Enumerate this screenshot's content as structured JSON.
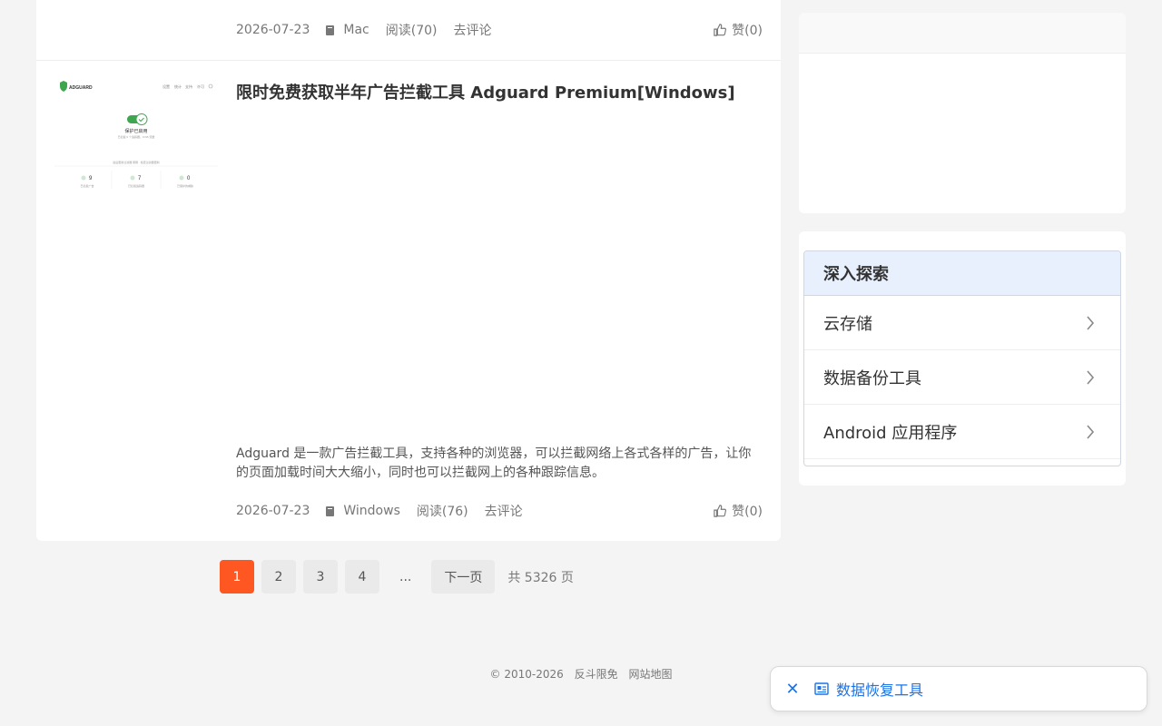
{
  "posts": [
    {
      "date": "2026-07-23",
      "category": "Mac",
      "reads": "阅读(70)",
      "comment": "去评论",
      "like": "赞(0)"
    },
    {
      "title": "限时免费获取半年广告拦截工具 Adguard Premium[Windows]",
      "excerpt": "Adguard 是一款广告拦截工具，支持各种的浏览器，可以拦截网络上各式各样的广告，让你的页面加载时间大大缩小，同时也可以拦截网上的各种跟踪信息。",
      "date": "2026-07-23",
      "category": "Windows",
      "reads": "阅读(76)",
      "comment": "去评论",
      "like": "赞(0)",
      "thumb": {
        "brand": "ADGUARD",
        "nav": [
          "设置",
          "统计",
          "支持",
          "许可"
        ],
        "status": "保护已启用",
        "status_sub": "已拦截 0 个追踪器，0 KB 流量",
        "footer_note": "最后更新过滤器 刚刚 · 检查过滤器更新",
        "stats": [
          {
            "value": "9",
            "label": "已拦截广告"
          },
          {
            "value": "7",
            "label": "已拦截追踪器"
          },
          {
            "value": "0",
            "label": "已保护的威胁"
          }
        ]
      }
    }
  ],
  "pagination": {
    "pages": [
      "1",
      "2",
      "3",
      "4"
    ],
    "dots": "...",
    "next": "下一页",
    "total": "共 5326 页"
  },
  "sidebar": {
    "explore_title": "深入探索",
    "explore_items": [
      "云存储",
      "数据备份工具",
      "Android 应用程序"
    ]
  },
  "footer": {
    "copyright": "© 2010-2026",
    "site": "反斗限免",
    "sitemap": "网站地图"
  },
  "toast": {
    "label": "数据恢复工具",
    "close": "✕"
  },
  "colors": {
    "accent": "#ff5722",
    "link": "#1a73e8",
    "explore_header_bg": "#e8f0fe"
  }
}
